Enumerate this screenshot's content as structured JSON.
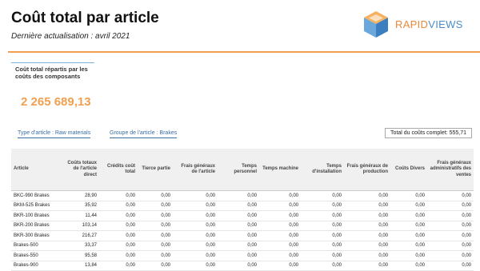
{
  "header": {
    "title": "Coût total par article",
    "subtitle": "Dernière actualisation : avril 2021",
    "brand_rapid": "RAPID",
    "brand_views": "VIEWS"
  },
  "kpi": {
    "label": "Coût total répartis par les coûts des composants",
    "value": "2 265 689,13"
  },
  "filters": {
    "type_article": "Type d'article : Raw materials",
    "groupe_article": "Groupe de l'article : Brakes",
    "total": "Total du coûts complet: 555,71"
  },
  "table": {
    "headers": [
      "Article",
      "Coûts totaux de l'article direct",
      "Crédits coût total",
      "Tierce partie",
      "Frais généraux de l'article",
      "Temps personnel",
      "Temps machine",
      "Temps d'installation",
      "Frais généraux de production",
      "Coûts Divers",
      "Frais généraux administratifs des ventes"
    ],
    "rows": [
      [
        "BKC-990 Brakes",
        "28,90",
        "0,00",
        "0,00",
        "0,00",
        "0,00",
        "0,00",
        "0,00",
        "0,00",
        "0,00",
        "0,00"
      ],
      [
        "BKM-525 Brakes",
        "35,92",
        "0,00",
        "0,00",
        "0,00",
        "0,00",
        "0,00",
        "0,00",
        "0,00",
        "0,00",
        "0,00"
      ],
      [
        "BKR-100 Brakes",
        "11,44",
        "0,00",
        "0,00",
        "0,00",
        "0,00",
        "0,00",
        "0,00",
        "0,00",
        "0,00",
        "0,00"
      ],
      [
        "BKR-200 Brakes",
        "103,14",
        "0,00",
        "0,00",
        "0,00",
        "0,00",
        "0,00",
        "0,00",
        "0,00",
        "0,00",
        "0,00"
      ],
      [
        "BKR-300 Brakes",
        "216,27",
        "0,00",
        "0,00",
        "0,00",
        "0,00",
        "0,00",
        "0,00",
        "0,00",
        "0,00",
        "0,00"
      ],
      [
        "Brakes-500",
        "33,37",
        "0,00",
        "0,00",
        "0,00",
        "0,00",
        "0,00",
        "0,00",
        "0,00",
        "0,00",
        "0,00"
      ],
      [
        "Brakes-550",
        "95,58",
        "0,00",
        "0,00",
        "0,00",
        "0,00",
        "0,00",
        "0,00",
        "0,00",
        "0,00",
        "0,00"
      ],
      [
        "Brakes-900",
        "13,84",
        "0,00",
        "0,00",
        "0,00",
        "0,00",
        "0,00",
        "0,00",
        "0,00",
        "0,00",
        "0,00"
      ]
    ]
  },
  "colors": {
    "accent_orange": "#f0a050",
    "accent_blue": "#4a8fc9"
  }
}
